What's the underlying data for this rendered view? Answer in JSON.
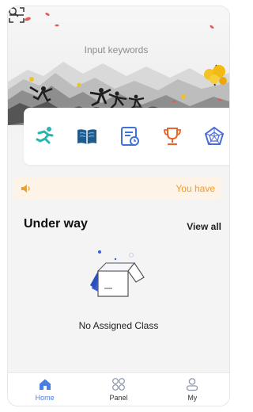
{
  "search": {
    "placeholder": "Input keywords"
  },
  "quick_icons": [
    {
      "icon": "running-icon",
      "color": "#2bb5b0"
    },
    {
      "icon": "book-icon",
      "color": "#1f5b8c"
    },
    {
      "icon": "schedule-icon",
      "color": "#3f73d8"
    },
    {
      "icon": "trophy-icon",
      "color": "#e8652b"
    },
    {
      "icon": "pentagon-chart-icon",
      "color": "#4a6bd8"
    }
  ],
  "notice": {
    "icon": "speaker-icon",
    "text": "You have",
    "color": "#f29d2c"
  },
  "section": {
    "title": "Under way",
    "view_all": "View all"
  },
  "empty_state": {
    "icon": "empty-box-icon",
    "text": "No Assigned Class"
  },
  "nav": {
    "items": [
      {
        "label": "Home",
        "icon": "home-icon",
        "active": true
      },
      {
        "label": "Panel",
        "icon": "panel-icon",
        "active": false
      },
      {
        "label": "My",
        "icon": "user-icon",
        "active": false
      }
    ],
    "active_color": "#4a7fe0"
  }
}
